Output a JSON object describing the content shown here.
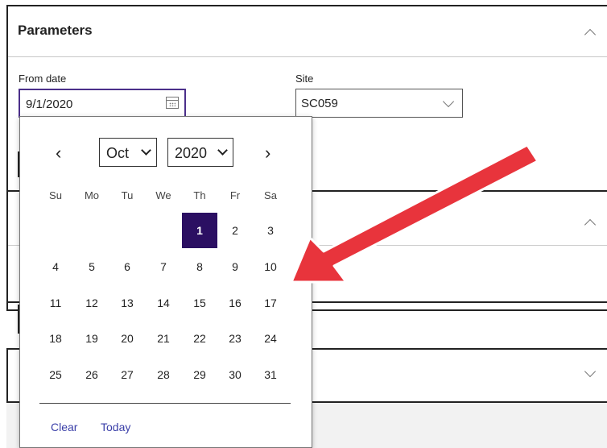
{
  "parameters": {
    "title": "Parameters",
    "from_date": {
      "label": "From date",
      "value": "9/1/2020"
    },
    "site": {
      "label": "Site",
      "value": "SC059"
    }
  },
  "calendar": {
    "month": "Oct",
    "year": "2020",
    "weekdays": [
      "Su",
      "Mo",
      "Tu",
      "We",
      "Th",
      "Fr",
      "Sa"
    ],
    "weeks": [
      [
        "",
        "",
        "",
        "",
        "1",
        "2",
        "3"
      ],
      [
        "4",
        "5",
        "6",
        "7",
        "8",
        "9",
        "10"
      ],
      [
        "11",
        "12",
        "13",
        "14",
        "15",
        "16",
        "17"
      ],
      [
        "18",
        "19",
        "20",
        "21",
        "22",
        "23",
        "24"
      ],
      [
        "25",
        "26",
        "27",
        "28",
        "29",
        "30",
        "31"
      ]
    ],
    "selected_day": "1",
    "clear_label": "Clear",
    "today_label": "Today",
    "prev_icon": "‹",
    "next_icon": "›"
  },
  "annotation": {
    "arrow_color": "#e8343c"
  },
  "colors": {
    "accent": "#2b0f62",
    "focus_border": "#4b2f8a",
    "link": "#3a3fa8"
  }
}
